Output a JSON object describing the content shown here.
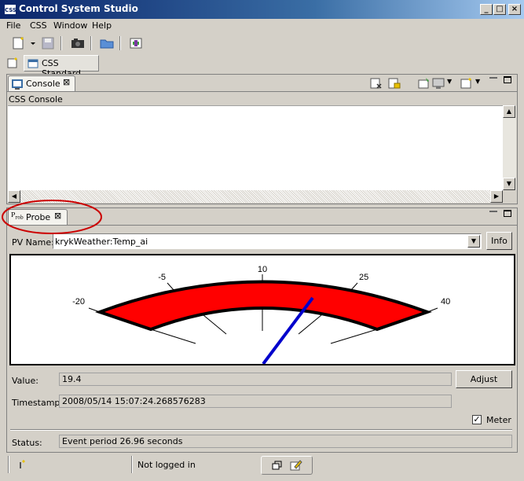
{
  "window": {
    "title": "Control System Studio",
    "icon_text": "CSS"
  },
  "menu": [
    "File",
    "CSS",
    "Window",
    "Help"
  ],
  "perspective": {
    "tab_label": "CSS Standard"
  },
  "console": {
    "tab_label": "Console",
    "header": "CSS Console"
  },
  "probe": {
    "tab_label": "Probe",
    "pv_label": "PV Name:",
    "pv_value": "krykWeather:Temp_ai",
    "info_label": "Info",
    "value_label": "Value:",
    "value": "19.4",
    "adjust_label": "Adjust",
    "timestamp_label": "Timestamp:",
    "timestamp": "2008/05/14 15:07:24.268576283",
    "meter_label": "Meter",
    "meter_checked": true,
    "status_label": "Status:",
    "status": "Event period 26.96 seconds"
  },
  "meter": {
    "scale_labels": [
      "-20",
      "-5",
      "10",
      "25",
      "40"
    ],
    "value": 19.4,
    "min": -20,
    "max": 40,
    "arc_color": "#ff0000",
    "needle_color": "#0000cc"
  },
  "statusbar": {
    "login": "Not logged in"
  },
  "highlight_color": "#cc0000"
}
